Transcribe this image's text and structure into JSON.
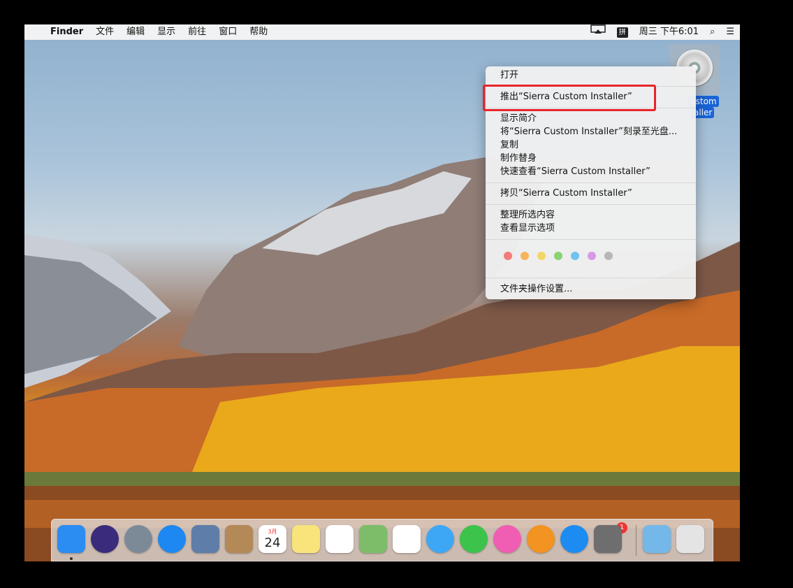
{
  "menubar": {
    "apple_glyph": "",
    "app_name": "Finder",
    "items": [
      "文件",
      "编辑",
      "显示",
      "前往",
      "窗口",
      "帮助"
    ],
    "ime_label": "拼",
    "clock": "周三 下午6:01",
    "search_glyph": "⌕",
    "list_glyph": "☰"
  },
  "desktop": {
    "disk_label_line1": "ustom",
    "disk_label_line2": "aller"
  },
  "context_menu": {
    "open": "打开",
    "eject": "推出“Sierra Custom Installer”",
    "get_info": "显示简介",
    "burn": "将“Sierra Custom Installer”刻录至光盘...",
    "duplicate": "复制",
    "make_alias": "制作替身",
    "quick_look": "快速查看“Sierra Custom Installer”",
    "copy": "拷贝“Sierra Custom Installer”",
    "clean_up": "整理所选内容",
    "view_options": "查看显示选项",
    "folder_actions": "文件夹操作设置...",
    "tag_colors": [
      "#f47b7b",
      "#f6b45a",
      "#f4d666",
      "#88d372",
      "#6fc3ef",
      "#d59ae6",
      "#b7b7b7"
    ]
  },
  "dock": {
    "calendar_month": "3月",
    "calendar_day": "24",
    "badge_count": "1",
    "apps": [
      {
        "name": "finder",
        "color": "#2b8cf1"
      },
      {
        "name": "siri",
        "color": "#3a2b7c"
      },
      {
        "name": "launchpad",
        "color": "#7c8a98"
      },
      {
        "name": "safari",
        "color": "#1d88f1"
      },
      {
        "name": "mail",
        "color": "#5e7ea9"
      },
      {
        "name": "contacts",
        "color": "#b38957"
      },
      {
        "name": "calendar",
        "color": "#ffffff"
      },
      {
        "name": "notes",
        "color": "#f8e47a"
      },
      {
        "name": "reminders",
        "color": "#ffffff"
      },
      {
        "name": "maps",
        "color": "#7dbd6a"
      },
      {
        "name": "photos",
        "color": "#ffffff"
      },
      {
        "name": "messages",
        "color": "#3ea7f5"
      },
      {
        "name": "facetime",
        "color": "#3cc34b"
      },
      {
        "name": "itunes",
        "color": "#f05eb3"
      },
      {
        "name": "ibooks",
        "color": "#f39321"
      },
      {
        "name": "app-store",
        "color": "#1c8cf2"
      },
      {
        "name": "system-preferences",
        "color": "#6e6e6e"
      },
      {
        "name": "downloads",
        "color": "#73b8e8"
      },
      {
        "name": "trash",
        "color": "#e4e4e4"
      }
    ]
  }
}
